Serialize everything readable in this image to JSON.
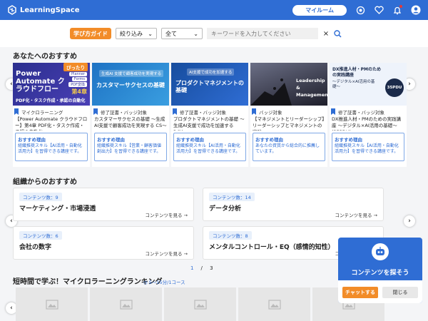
{
  "header": {
    "logo": "LearningSpace",
    "myroom_label": "マイルーム"
  },
  "search": {
    "guide_label": "学び方ガイド",
    "filter_label": "絞り込み",
    "category_value": "全て",
    "keyword_placeholder": "キーワードを入力してください",
    "clear_label": "×"
  },
  "recommend": {
    "title": "あなたへのおすすめ",
    "reason_label": "おすすめ理由",
    "cards": [
      {
        "thumb_main": "Power Automate クラウドフロー",
        "thumb_sub": "PDF化・タスク作成・承認の自動化",
        "thumb_badge": "ぴったり",
        "thumb_tag": "PDF変換",
        "thumb_part": "第4章",
        "thumb_chip1": "Planner",
        "thumb_chip2": "Forms",
        "tag": "マイクロラーニング",
        "title": "【Power Automate クラウドフロー】第4章 PDF化・タスク作成・承認の自動化",
        "reason": "組織推奨スキル【AI活用・自動化活用力】を習得できる講座です。",
        "bg": "#3b3f9e"
      },
      {
        "thumb_main": "カスタマーサクセスの基礎",
        "thumb_sub": "生成AI 支援で顧客成功を実現する",
        "tag": "修了証書・バッジ対象",
        "title": "カスタマーサクセスの基礎 〜生成AI支援で顧客成功を実現する CS〜",
        "reason": "組織推奨スキル【営業・顧客価値創出力】を習得できる講座です。",
        "bg": "#2b84c9"
      },
      {
        "thumb_main": "プロダクトマネジメントの基礎",
        "thumb_sub": "AI支援で成功を加速する",
        "tag": "修了証書・バッジ対象",
        "title": "プロダクトマネジメントの基礎 〜生成AI支援で成功を加速する PdM〜",
        "reason": "組織推奨スキル【AI活用・自動化活用力】を習得できる講座です。",
        "bg": "#1f5fb8"
      },
      {
        "thumb_main": "Leadership & Management",
        "tag": "バッジ対象",
        "title": "【マネジメントとリーダーシップ】リーダーシップとマネジメントの実践…",
        "reason": "あなたの資質から総合的に推薦しています。",
        "bg": "#2a2a3a"
      },
      {
        "thumb_main": "DX推進人材・PMのための実践講座",
        "thumb_sub": "〜デジタル×AI活用の基礎〜",
        "thumb_badge": "35PDU",
        "tag": "修了証書・バッジ対象",
        "title": "DX推進人材・PMのための実践講座 〜デジタル×AI活用の基礎〜(35PDU)",
        "reason": "組織推奨スキル【AI活用・自動化活用力】を習得できる講座です。",
        "bg": "#eef3fb"
      }
    ]
  },
  "org": {
    "title": "組織からのおすすめ",
    "more_label": "コンテンツを見る",
    "items": [
      {
        "count": "コンテンツ数：9",
        "name": "マーケティング・市場浸透"
      },
      {
        "count": "コンテンツ数：14",
        "name": "データ分析"
      },
      {
        "count": "コンテンツ数：6",
        "name": "会社の数字"
      },
      {
        "count": "コンテンツ数：8",
        "name": "メンタルコントロール・EQ（感情的知性）"
      }
    ],
    "page_current": "1",
    "page_total": "3"
  },
  "ranking": {
    "title": "短時間で学ぶ！マイクロラーニングランキング",
    "note": "5〜15分/1コース"
  },
  "chat": {
    "title": "コンテンツを探そう",
    "chat_label": "チャットする",
    "close_label": "閉じる"
  },
  "colors": {
    "brand": "#2f6dd4",
    "accent": "#f28c28"
  }
}
